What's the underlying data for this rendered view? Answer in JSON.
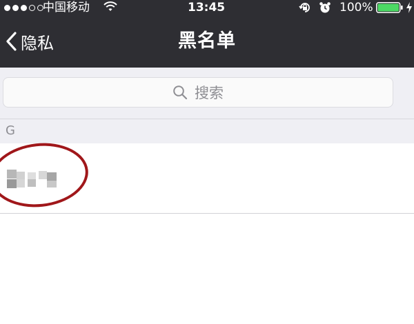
{
  "status_bar": {
    "carrier": "中国移动",
    "time": "13:45",
    "battery": "100%",
    "signal_bars": 3,
    "signal_total": 5,
    "battery_level": 1.0,
    "icons": [
      "wifi-icon",
      "rotation-lock-icon",
      "alarm-icon",
      "battery-icon",
      "charging-bolt-icon"
    ]
  },
  "nav": {
    "back_label": "隐私",
    "title": "黑名单"
  },
  "search": {
    "placeholder": "搜索"
  },
  "sections": [
    {
      "letter": "G",
      "items": [
        {
          "name": "",
          "pixelated": true
        }
      ]
    }
  ],
  "colors": {
    "bar_bg": "#2e2e33",
    "page_bg": "#efeff4",
    "annotation_circle": "#a0171a",
    "battery_green": "#4cd964"
  }
}
